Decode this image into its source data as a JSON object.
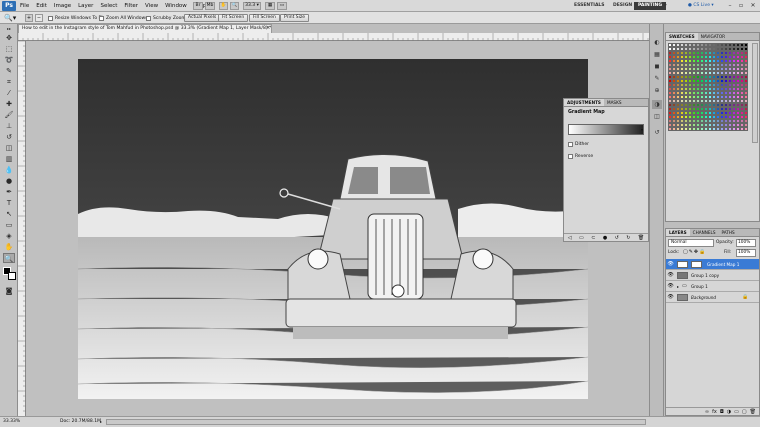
{
  "app": {
    "logo": "Ps",
    "menus": [
      "File",
      "Edit",
      "Image",
      "Layer",
      "Select",
      "Filter",
      "View",
      "Window",
      "Help"
    ],
    "zoom_display": "33.3",
    "workspaces": [
      "ESSENTIALS",
      "DESIGN",
      "PAINTING"
    ],
    "active_workspace": "PAINTING",
    "cs_live": "CS Live"
  },
  "options_bar": {
    "resize_windows": "Resize Windows To Fit",
    "zoom_all": "Zoom All Windows",
    "scrubby_zoom": "Scrubby Zoom",
    "actual_pixels": "Actual Pixels",
    "fit_screen": "Fit Screen",
    "fill_screen": "Fill Screen",
    "print_size": "Print Size"
  },
  "document": {
    "tab_title": "How to edit in the Instagram style of Tom Mahfud in Photoshop.psd @ 33.3% (Gradient Map 1, Layer Mask/8) *",
    "close": "×"
  },
  "status_bar": {
    "zoom": "33.33%",
    "doc_info": "Doc: 20.7M/88.1M"
  },
  "adjustments": {
    "tabs": [
      "ADJUSTMENTS",
      "MASKS"
    ],
    "title": "Gradient Map",
    "dither": "Dither",
    "reverse": "Reverse"
  },
  "swatches": {
    "tabs": [
      "SWATCHES",
      "NAVIGATOR"
    ]
  },
  "layers": {
    "tabs": [
      "LAYERS",
      "CHANNELS",
      "PATHS"
    ],
    "blend_mode": "Normal",
    "opacity_label": "Opacity:",
    "opacity_value": "100%",
    "lock_label": "Lock:",
    "fill_label": "Fill:",
    "fill_value": "100%",
    "items": [
      {
        "name": "Gradient Map 1",
        "selected": true
      },
      {
        "name": "Group 1 copy",
        "selected": false
      },
      {
        "name": "Group 1",
        "selected": false
      },
      {
        "name": "Background",
        "selected": false
      }
    ]
  },
  "colors": {
    "accent": "#3a7bd5",
    "panel": "#d6d6d6"
  }
}
